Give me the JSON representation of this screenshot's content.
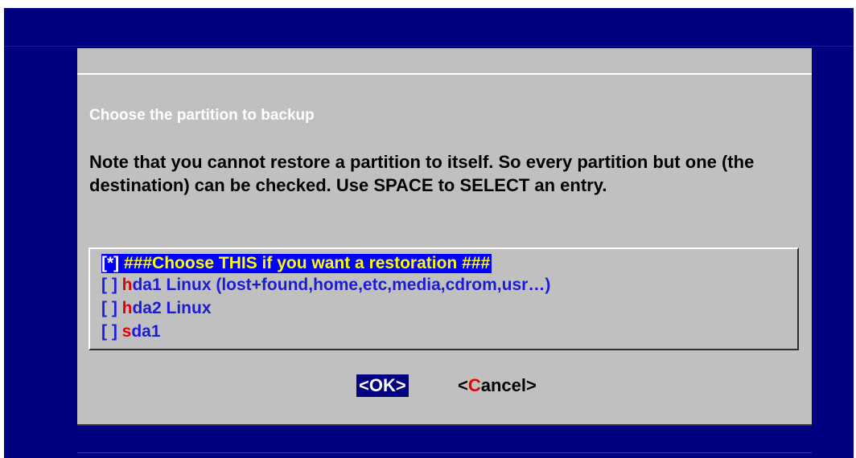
{
  "dialog": {
    "title": "Choose the partition to backup",
    "message": "Note that you cannot restore a partition to itself. So every partition but one (the destination) can be checked. Use SPACE to SELECT an entry."
  },
  "list": {
    "items": [
      {
        "check": "[*] ",
        "hotkey": "#",
        "rest": "##Choose THIS if you want a restoration ###",
        "checked": true,
        "selected": true
      },
      {
        "check": "[ ] ",
        "hotkey": "h",
        "rest": "da1 Linux (lost+found,home,etc,media,cdrom,usr…)",
        "checked": false,
        "selected": false
      },
      {
        "check": "[ ] ",
        "hotkey": "h",
        "rest": "da2 Linux",
        "checked": false,
        "selected": false
      },
      {
        "check": "[ ] ",
        "hotkey": "s",
        "rest": "da1",
        "checked": false,
        "selected": false
      }
    ]
  },
  "buttons": {
    "ok": {
      "label": "<OK>",
      "focused": true
    },
    "cancel": {
      "open": "<",
      "hotkey": "C",
      "rest": "ancel>"
    }
  },
  "colors": {
    "screen_background": "#000080",
    "dialog_background": "#c0c0c0",
    "selection_background": "#0000ff",
    "selected_text": "#ffff00",
    "item_text": "#1c1cd6",
    "hotkey": "#e00000"
  }
}
